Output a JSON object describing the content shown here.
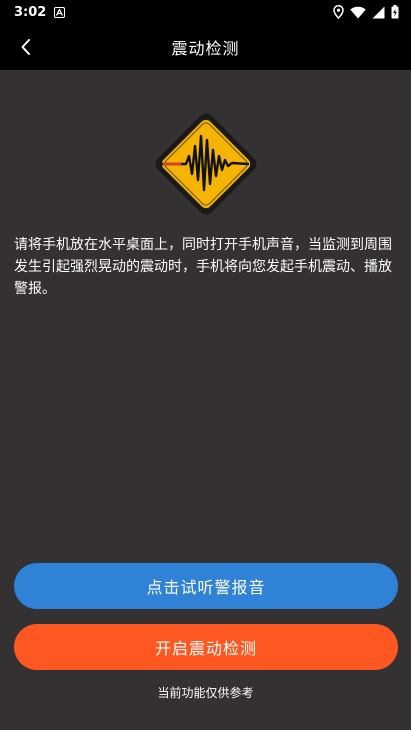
{
  "status_bar": {
    "time": "3:02",
    "notification_icon": "a-box-icon",
    "icons": [
      "location-icon",
      "wifi-icon",
      "signal-icon",
      "battery-charging-icon"
    ]
  },
  "app_bar": {
    "title": "震动检测",
    "back_icon": "chevron-left-icon"
  },
  "hero": {
    "icon": "earthquake-warning-sign-icon",
    "sign_color": "#F5B400",
    "wave_color": "#111111",
    "accent_color": "#E53935"
  },
  "main": {
    "description": "请将手机放在水平桌面上，同时打开手机声音，当监测到周围发生引起强烈晃动的震动时，手机将向您发起手机震动、播放警报。"
  },
  "buttons": {
    "preview_alarm": {
      "label": "点击试听警报音",
      "color": "#2F82D6"
    },
    "start_detection": {
      "label": "开启震动检测",
      "color": "#FF5722"
    }
  },
  "footer": {
    "disclaimer": "当前功能仅供参考"
  },
  "colors": {
    "background": "#333132",
    "bar": "#000000"
  }
}
